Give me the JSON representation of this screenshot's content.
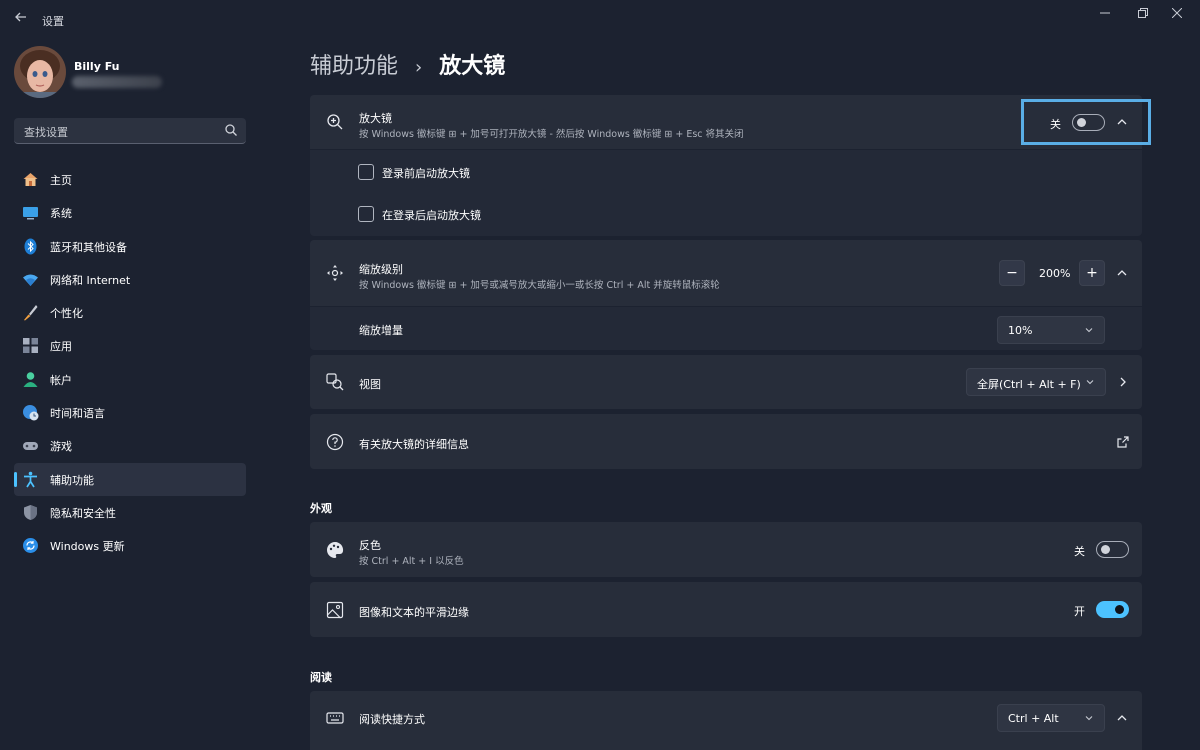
{
  "window": {
    "title": "设置"
  },
  "profile": {
    "name": "Billy Fu"
  },
  "search": {
    "placeholder": "查找设置"
  },
  "sidebar": {
    "items": [
      {
        "label": "主页",
        "icon": "home-icon"
      },
      {
        "label": "系统",
        "icon": "monitor-icon"
      },
      {
        "label": "蓝牙和其他设备",
        "icon": "bluetooth-icon"
      },
      {
        "label": "网络和 Internet",
        "icon": "wifi-icon"
      },
      {
        "label": "个性化",
        "icon": "brush-icon"
      },
      {
        "label": "应用",
        "icon": "apps-icon"
      },
      {
        "label": "帐户",
        "icon": "person-icon"
      },
      {
        "label": "时间和语言",
        "icon": "globe-clock-icon"
      },
      {
        "label": "游戏",
        "icon": "gamepad-icon"
      },
      {
        "label": "辅助功能",
        "icon": "accessibility-icon",
        "active": true
      },
      {
        "label": "隐私和安全性",
        "icon": "shield-icon"
      },
      {
        "label": "Windows 更新",
        "icon": "update-icon"
      }
    ]
  },
  "breadcrumb": {
    "parent": "辅助功能",
    "separator": "›",
    "current": "放大镜"
  },
  "magnifier": {
    "title": "放大镜",
    "description": "按 Windows 徽标键 ⊞ + 加号可打开放大镜 - 然后按 Windows 徽标键 ⊞ + Esc 将其关闭",
    "toggle_label": "关",
    "toggle_on": false,
    "options": [
      {
        "label": "登录前启动放大镜",
        "checked": false
      },
      {
        "label": "在登录后启动放大镜",
        "checked": false
      }
    ]
  },
  "zoom": {
    "title": "缩放级别",
    "description": "按 Windows 徽标键 ⊞ + 加号或减号放大或缩小一或长按 Ctrl + Alt 并旋转鼠标滚轮",
    "minus": "−",
    "value": "200%",
    "plus": "+",
    "increment_label": "缩放增量",
    "increment_value": "10%"
  },
  "view": {
    "title": "视图",
    "value": "全屏(Ctrl + Alt + F)"
  },
  "more_info": {
    "title": "有关放大镜的详细信息"
  },
  "appearance": {
    "heading": "外观",
    "invert": {
      "title": "反色",
      "description": "按 Ctrl + Alt + I 以反色",
      "toggle_label": "关",
      "toggle_on": false
    },
    "smooth": {
      "title": "图像和文本的平滑边缘",
      "toggle_label": "开",
      "toggle_on": true
    }
  },
  "reading": {
    "heading": "阅读",
    "shortcut": {
      "title": "阅读快捷方式",
      "value": "Ctrl + Alt"
    }
  },
  "colors": {
    "accent": "#4cc2ff",
    "focus": "#5aaee6",
    "background": "#1c2230",
    "card": "#272d3a"
  }
}
